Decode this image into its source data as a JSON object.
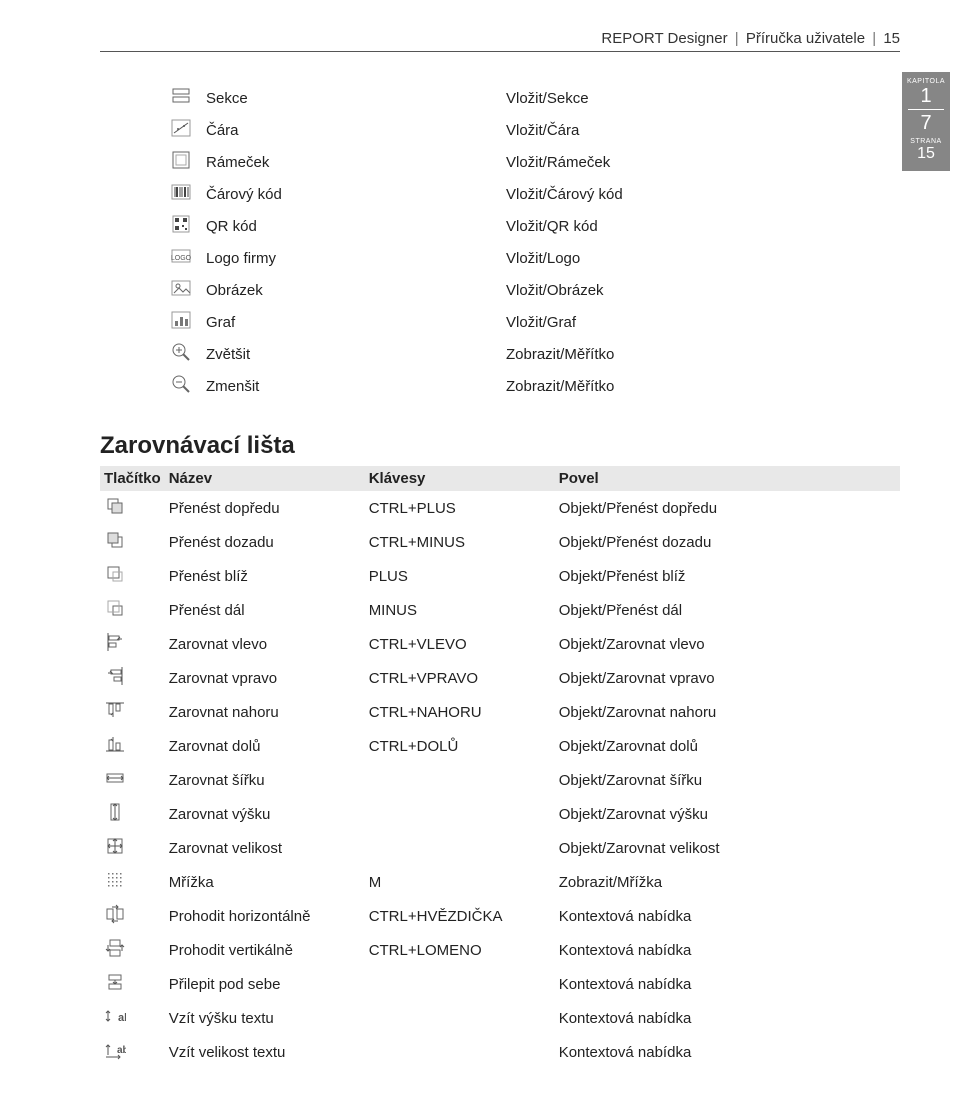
{
  "header": {
    "product": "REPORT Designer",
    "doc": "Příručka uživatele",
    "page": "15"
  },
  "sidebar": {
    "kapitola_label": "KAPITOLA",
    "chapter": "1",
    "sub": "7",
    "strana_label": "STRANA",
    "page": "15"
  },
  "table1": {
    "rows": [
      {
        "icon": "section",
        "name": "Sekce",
        "cmd": "Vložit/Sekce"
      },
      {
        "icon": "line",
        "name": "Čára",
        "cmd": "Vložit/Čára"
      },
      {
        "icon": "frame",
        "name": "Rámeček",
        "cmd": "Vložit/Rámeček"
      },
      {
        "icon": "barcode",
        "name": "Čárový kód",
        "cmd": "Vložit/Čárový kód"
      },
      {
        "icon": "qr",
        "name": "QR kód",
        "cmd": "Vložit/QR kód"
      },
      {
        "icon": "logo",
        "name": "Logo firmy",
        "cmd": "Vložit/Logo"
      },
      {
        "icon": "image",
        "name": "Obrázek",
        "cmd": "Vložit/Obrázek"
      },
      {
        "icon": "chart",
        "name": "Graf",
        "cmd": "Vložit/Graf"
      },
      {
        "icon": "zoomin",
        "name": "Zvětšit",
        "cmd": "Zobrazit/Měřítko"
      },
      {
        "icon": "zoomout",
        "name": "Zmenšit",
        "cmd": "Zobrazit/Měřítko"
      }
    ]
  },
  "section2_title": "Zarovnávací lišta",
  "table2": {
    "headers": {
      "btn": "Tlačítko",
      "name": "Název",
      "keys": "Klávesy",
      "cmd": "Povel"
    },
    "rows": [
      {
        "icon": "bring-front",
        "name": "Přenést dopředu",
        "keys": "CTRL+PLUS",
        "cmd": "Objekt/Přenést dopředu"
      },
      {
        "icon": "send-back",
        "name": "Přenést dozadu",
        "keys": "CTRL+MINUS",
        "cmd": "Objekt/Přenést dozadu"
      },
      {
        "icon": "bring-near",
        "name": "Přenést blíž",
        "keys": "PLUS",
        "cmd": "Objekt/Přenést blíž"
      },
      {
        "icon": "send-far",
        "name": "Přenést dál",
        "keys": "MINUS",
        "cmd": "Objekt/Přenést dál"
      },
      {
        "icon": "align-left",
        "name": "Zarovnat vlevo",
        "keys": "CTRL+VLEVO",
        "cmd": "Objekt/Zarovnat vlevo"
      },
      {
        "icon": "align-right",
        "name": "Zarovnat vpravo",
        "keys": "CTRL+VPRAVO",
        "cmd": "Objekt/Zarovnat vpravo"
      },
      {
        "icon": "align-top",
        "name": "Zarovnat nahoru",
        "keys": "CTRL+NAHORU",
        "cmd": "Objekt/Zarovnat nahoru"
      },
      {
        "icon": "align-bottom",
        "name": "Zarovnat dolů",
        "keys": "CTRL+DOLŮ",
        "cmd": "Objekt/Zarovnat dolů"
      },
      {
        "icon": "align-width",
        "name": "Zarovnat šířku",
        "keys": "",
        "cmd": "Objekt/Zarovnat šířku"
      },
      {
        "icon": "align-height",
        "name": "Zarovnat výšku",
        "keys": "",
        "cmd": "Objekt/Zarovnat výšku"
      },
      {
        "icon": "align-size",
        "name": "Zarovnat velikost",
        "keys": "",
        "cmd": "Objekt/Zarovnat velikost"
      },
      {
        "icon": "grid",
        "name": "Mřížka",
        "keys": "M",
        "cmd": "Zobrazit/Mřížka"
      },
      {
        "icon": "swap-h",
        "name": "Prohodit horizontálně",
        "keys": "CTRL+HVĚZDIČKA",
        "cmd": "Kontextová nabídka"
      },
      {
        "icon": "swap-v",
        "name": "Prohodit vertikálně",
        "keys": "CTRL+LOMENO",
        "cmd": "Kontextová nabídka"
      },
      {
        "icon": "stick-below",
        "name": "Přilepit pod sebe",
        "keys": "",
        "cmd": "Kontextová nabídka"
      },
      {
        "icon": "take-th",
        "name": "Vzít výšku textu",
        "keys": "",
        "cmd": "Kontextová nabídka"
      },
      {
        "icon": "take-ts",
        "name": "Vzít velikost textu",
        "keys": "",
        "cmd": "Kontextová nabídka"
      }
    ]
  }
}
